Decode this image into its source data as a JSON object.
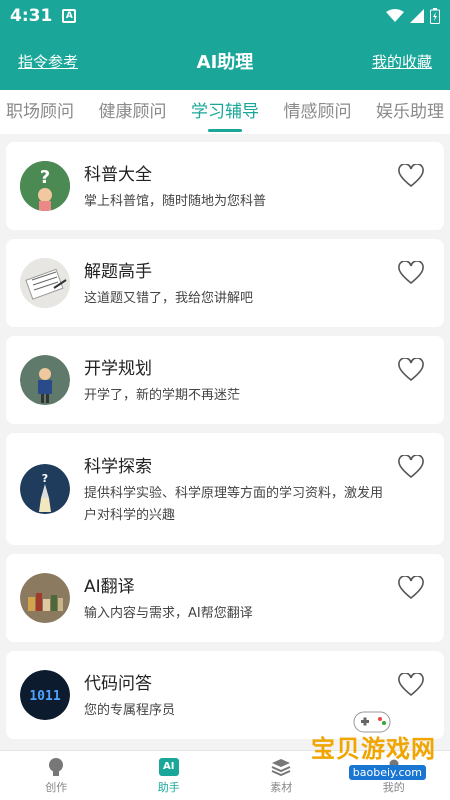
{
  "status_bar": {
    "time": "4:31",
    "notif_glyph": "A"
  },
  "header": {
    "left_link": "指令参考",
    "title": "AI助理",
    "right_link": "我的收藏"
  },
  "tabs": [
    {
      "label": "职场顾问",
      "active": false
    },
    {
      "label": "健康顾问",
      "active": false
    },
    {
      "label": "学习辅导",
      "active": true
    },
    {
      "label": "情感顾问",
      "active": false
    },
    {
      "label": "娱乐助理",
      "active": false
    }
  ],
  "cards": [
    {
      "name": "科普大全",
      "desc": "掌上科普馆，随时随地为您科普",
      "avatar_icon": "question-child-avatar"
    },
    {
      "name": "解题高手",
      "desc": "这道题又错了，我给您讲解吧",
      "avatar_icon": "notebook-pen-avatar"
    },
    {
      "name": "开学规划",
      "desc": "开学了，新的学期不再迷茫",
      "avatar_icon": "student-avatar"
    },
    {
      "name": "科学探索",
      "desc": "提供科学实验、科学原理等方面的学习资料，激发用户对科学的兴趣",
      "avatar_icon": "rocket-avatar"
    },
    {
      "name": "AI翻译",
      "desc": "输入内容与需求，AI帮您翻译",
      "avatar_icon": "books-avatar"
    },
    {
      "name": "代码问答",
      "desc": "您的专属程序员",
      "avatar_icon": "binary-avatar"
    }
  ],
  "bottom_nav": [
    {
      "label": "创作",
      "icon": "bulb-icon",
      "active": false
    },
    {
      "label": "助手",
      "icon": "ai-icon",
      "badge": "AI",
      "active": true
    },
    {
      "label": "素材",
      "icon": "layers-icon",
      "active": false
    },
    {
      "label": "我的",
      "icon": "user-icon",
      "active": false
    }
  ],
  "watermark": {
    "title": "宝贝游戏网",
    "url": "baobeiy.com"
  },
  "colors": {
    "accent": "#1aa79a",
    "background": "#f3f3f3"
  }
}
